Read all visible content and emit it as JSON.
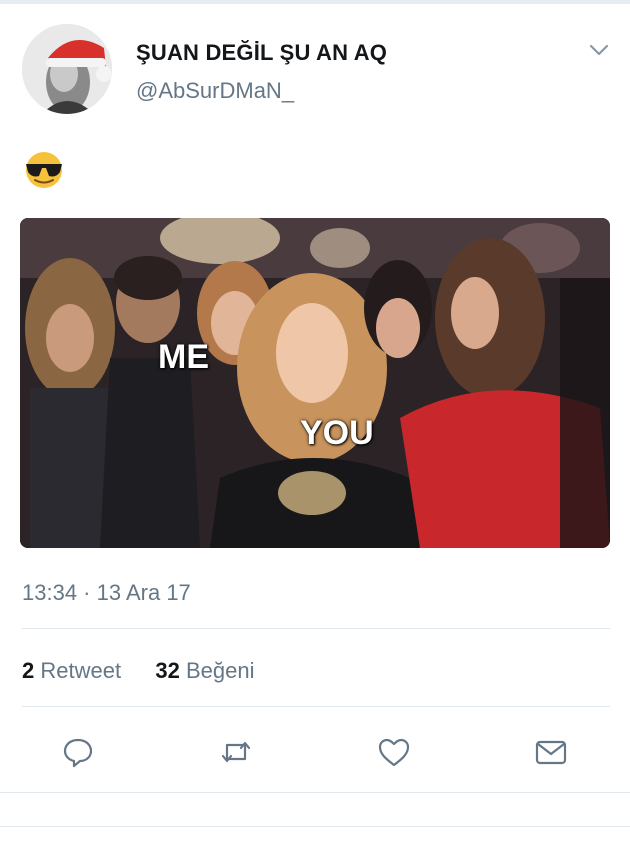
{
  "tweet": {
    "author": {
      "display_name": "ŞUAN DEĞİL ŞU AN AQ",
      "handle": "@AbSurDMaN_"
    },
    "text_emoji": "😎",
    "media": {
      "captions": [
        "ME",
        "YOU"
      ]
    },
    "timestamp": "13:34 · 13 Ara 17",
    "stats": {
      "retweets_count": "2",
      "retweets_label": "Retweet",
      "likes_count": "32",
      "likes_label": "Beğeni"
    },
    "actions": [
      "reply-icon",
      "retweet-icon",
      "like-icon",
      "direct-message-icon"
    ]
  },
  "colors": {
    "primary_text": "#14171a",
    "secondary_text": "#657786",
    "divider": "#e1e8ed",
    "action_icon": "#657786"
  }
}
